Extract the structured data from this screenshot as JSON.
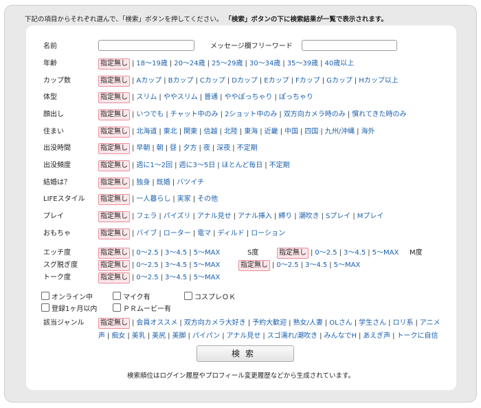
{
  "intro": {
    "before": "下記の項目からそれぞれ選んで、「検索」ボタンを押してください。",
    "bold": "「検索」ボタンの下に検索結果が一覧で表示されます。"
  },
  "fields": {
    "name_label": "名前",
    "message_label": "メッセージ欄フリーワード"
  },
  "rows": [
    {
      "label": "年齢",
      "options": [
        "指定無し",
        "18～19歳",
        "20～24歳",
        "25～29歳",
        "30～34歳",
        "35～39歳",
        "40歳以上"
      ]
    },
    {
      "label": "カップ数",
      "options": [
        "指定無し",
        "Aカップ",
        "Bカップ",
        "Cカップ",
        "Dカップ",
        "Eカップ",
        "Fカップ",
        "Gカップ",
        "Hカップ以上"
      ]
    },
    {
      "label": "体型",
      "options": [
        "指定無し",
        "スリム",
        "ややスリム",
        "普通",
        "ややぽっちゃり",
        "ぽっちゃり"
      ]
    },
    {
      "label": "顔出し",
      "options": [
        "指定無し",
        "いつでも",
        "チャット中のみ",
        "2ショット中のみ",
        "双方向カメラ時のみ",
        "慣れてきた時のみ"
      ]
    },
    {
      "label": "住まい",
      "options": [
        "指定無し",
        "北海道",
        "東北",
        "関東",
        "信越",
        "北陸",
        "東海",
        "近畿",
        "中国",
        "四国",
        "九州/沖縄",
        "海外"
      ]
    },
    {
      "label": "出没時間",
      "options": [
        "指定無し",
        "早朝",
        "朝",
        "昼",
        "夕方",
        "夜",
        "深夜",
        "不定期"
      ]
    },
    {
      "label": "出没頻度",
      "options": [
        "指定無し",
        "週に1～2回",
        "週に3～5日",
        "ほとんど毎日",
        "不定期"
      ]
    },
    {
      "label": "結婚は？",
      "options": [
        "指定無し",
        "独身",
        "既婚",
        "バツイチ"
      ]
    },
    {
      "label": "LIFEスタイル",
      "options": [
        "指定無し",
        "一人暮らし",
        "実家",
        "その他"
      ]
    },
    {
      "label": "プレイ",
      "options": [
        "指定無し",
        "フェラ",
        "パイズリ",
        "アナル見せ",
        "アナル挿入",
        "縛り",
        "潮吹き",
        "Sプレイ",
        "Mプレイ"
      ]
    },
    {
      "label": "おもちゃ",
      "options": [
        "指定無し",
        "バイブ",
        "ローター",
        "電マ",
        "ディルド",
        "ローション"
      ]
    }
  ],
  "degree": {
    "etchi_label": "エッチ度",
    "sugu_label": "スグ脱ぎ度",
    "talk_label": "トーク度",
    "s_label": "S度",
    "m_label": "M度",
    "scale": [
      "指定無し",
      "0～2.5",
      "3～4.5",
      "5～MAX"
    ]
  },
  "checks": [
    "オンライン中",
    "マイク有",
    "コスプレＯＫ",
    "登録1ヶ月以内",
    "ＰＲムービー有"
  ],
  "genre": {
    "label": "該当ジャンル",
    "line1": [
      "指定無し",
      "会員オススメ",
      "双方向カメラ大好き",
      "予約大歓迎",
      "熟女/人妻",
      "OLさん",
      "学生さん",
      "ロリ系",
      "アニメ"
    ],
    "line2": [
      "声",
      "痴女",
      "美乳",
      "美尻",
      "美脚",
      "パイパン",
      "アナル見せ",
      "スゴ濡れ/潮吹き",
      "みんなでH",
      "あえぎ声",
      "トークに自信"
    ]
  },
  "search_button": "検索",
  "footer_note": "検索順位はログイン履歴やプロフィール変更履歴などから生成されています。"
}
